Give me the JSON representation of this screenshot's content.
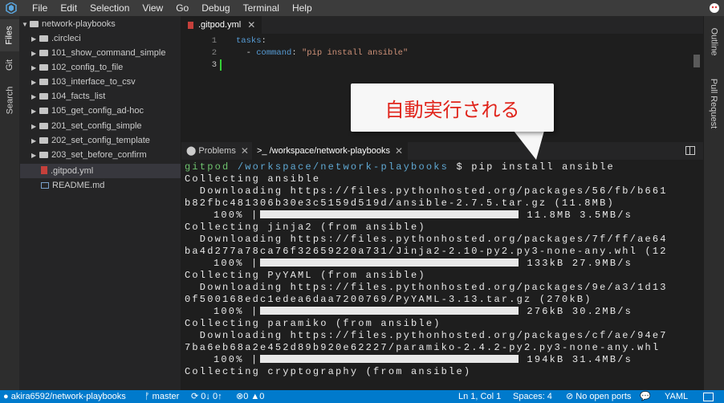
{
  "menubar": {
    "items": [
      "File",
      "Edit",
      "Selection",
      "View",
      "Go",
      "Debug",
      "Terminal",
      "Help"
    ]
  },
  "leftbar": {
    "tabs": [
      "Files",
      "Git",
      "Search"
    ]
  },
  "explorer": {
    "root": "network-playbooks",
    "items": [
      {
        "label": ".circleci",
        "type": "folder"
      },
      {
        "label": "101_show_command_simple",
        "type": "folder"
      },
      {
        "label": "102_config_to_file",
        "type": "folder"
      },
      {
        "label": "103_interface_to_csv",
        "type": "folder"
      },
      {
        "label": "104_facts_list",
        "type": "folder"
      },
      {
        "label": "105_get_config_ad-hoc",
        "type": "folder"
      },
      {
        "label": "201_set_config_simple",
        "type": "folder"
      },
      {
        "label": "202_set_config_template",
        "type": "folder"
      },
      {
        "label": "203_set_before_confirm",
        "type": "folder"
      },
      {
        "label": ".gitpod.yml",
        "type": "file-yml",
        "selected": true
      },
      {
        "label": "README.md",
        "type": "file-md"
      }
    ]
  },
  "editor": {
    "tab_label": ".gitpod.yml",
    "lines": {
      "l1": {
        "num": "1",
        "key": "tasks",
        "colon": ":"
      },
      "l2": {
        "num": "2",
        "dash": "  - ",
        "key": "command",
        "colon": ": ",
        "value": "\"pip install ansible\""
      },
      "l3": {
        "num": "3"
      }
    }
  },
  "panel": {
    "problems_label": "Problems",
    "terminal_label": ">_ /workspace/network-playbooks"
  },
  "terminal": {
    "prompt_user": "gitpod",
    "prompt_path": " /workspace/network-playbooks",
    "prompt_cmd": " $ pip install ansible",
    "lines": [
      "Collecting ansible",
      "  Downloading https://files.pythonhosted.org/packages/56/fb/b661",
      "b82fbc481306b30e3c5159d519d/ansible-2.7.5.tar.gz (11.8MB)",
      "Collecting jinja2 (from ansible)",
      "  Downloading https://files.pythonhosted.org/packages/7f/ff/ae64",
      "ba4d277a78ca76f32659220a731/Jinja2-2.10-py2.py3-none-any.whl (12",
      "Collecting PyYAML (from ansible)",
      "  Downloading https://files.pythonhosted.org/packages/9e/a3/1d13",
      "0f500168edc1edea6daa7200769/PyYAML-3.13.tar.gz (270kB)",
      "Collecting paramiko (from ansible)",
      "  Downloading https://files.pythonhosted.org/packages/cf/ae/94e7",
      "7ba6eb68a2e452d89b920e62227/paramiko-2.4.2-py2.py3-none-any.whl",
      "Collecting cryptography (from ansible)"
    ],
    "progress": [
      {
        "pct_label": "100%",
        "fill": 1.0,
        "stats": "11.8MB 3.5MB/s"
      },
      {
        "pct_label": "100%",
        "fill": 1.0,
        "stats": "133kB 27.9MB/s"
      },
      {
        "pct_label": "100%",
        "fill": 1.0,
        "stats": "276kB 30.2MB/s"
      },
      {
        "pct_label": "100%",
        "fill": 1.0,
        "stats": "194kB 31.4MB/s"
      }
    ]
  },
  "callout": {
    "text": "自動実行される"
  },
  "rightbar": {
    "tabs": [
      "Outline",
      "Pull Request"
    ]
  },
  "statusbar": {
    "repo": "akira6592/network-playbooks",
    "branch": "master",
    "sync": "0↓ 0↑",
    "errors": "0",
    "warnings": "0",
    "position": "Ln 1, Col 1",
    "spaces": "Spaces: 4",
    "ports": "No open ports",
    "language": "YAML"
  },
  "colors": {
    "statusbar": "#007acc",
    "callout_text": "#e0241b",
    "prompt_user": "#6ec26e",
    "prompt_path": "#5fa8d3"
  }
}
